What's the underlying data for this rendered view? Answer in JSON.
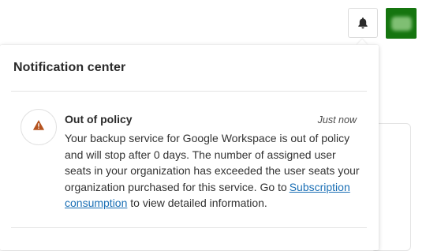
{
  "header": {
    "bell_icon": "bell-icon",
    "avatar_color": "#15750f"
  },
  "panel": {
    "title": "Notification center"
  },
  "notifications": [
    {
      "icon": "warning-triangle-icon",
      "icon_color": "#b5531f",
      "title": "Out of policy",
      "time": "Just now",
      "body_before_link": "Your backup service for Google Workspace is out of policy and will stop after 0 days. The number of assigned user seats in your organization has exceeded the user seats your organization purchased for this service. Go to",
      "link_text": "Subscription consumption",
      "body_after_link": " to view detailed information."
    }
  ]
}
